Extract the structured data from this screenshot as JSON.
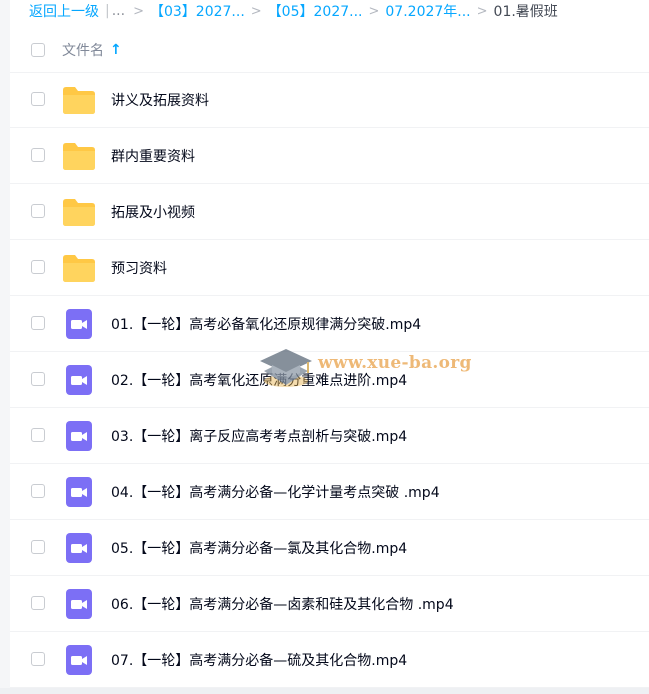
{
  "breadcrumb": {
    "back": "返回上一级",
    "ellipsis": "...",
    "crumbs": [
      "【03】2027...",
      "【05】2027...",
      "07.2027年..."
    ],
    "current": "01.暑假班"
  },
  "header": {
    "column_label": "文件名",
    "sort_icon": "arrow-up-icon"
  },
  "files": [
    {
      "type": "folder",
      "name": "讲义及拓展资料"
    },
    {
      "type": "folder",
      "name": "群内重要资料"
    },
    {
      "type": "folder",
      "name": "拓展及小视频"
    },
    {
      "type": "folder",
      "name": "预习资料"
    },
    {
      "type": "video",
      "name": "01.【一轮】高考必备氧化还原规律满分突破.mp4"
    },
    {
      "type": "video",
      "name": "02.【一轮】高考氧化还原满分重难点进阶.mp4"
    },
    {
      "type": "video",
      "name": "03.【一轮】离子反应高考考点剖析与突破.mp4"
    },
    {
      "type": "video",
      "name": "04.【一轮】高考满分必备—化学计量考点突破 .mp4"
    },
    {
      "type": "video",
      "name": "05.【一轮】高考满分必备—氯及其化合物.mp4"
    },
    {
      "type": "video",
      "name": "06.【一轮】高考满分必备—卤素和硅及其化合物 .mp4"
    },
    {
      "type": "video",
      "name": "07.【一轮】高考满分必备—硫及其化合物.mp4"
    }
  ],
  "watermark": {
    "text": "www.xue-ba.org"
  },
  "colors": {
    "accent": "#06a7ff",
    "folder": "#ffc845",
    "video": "#7c6ff5"
  }
}
